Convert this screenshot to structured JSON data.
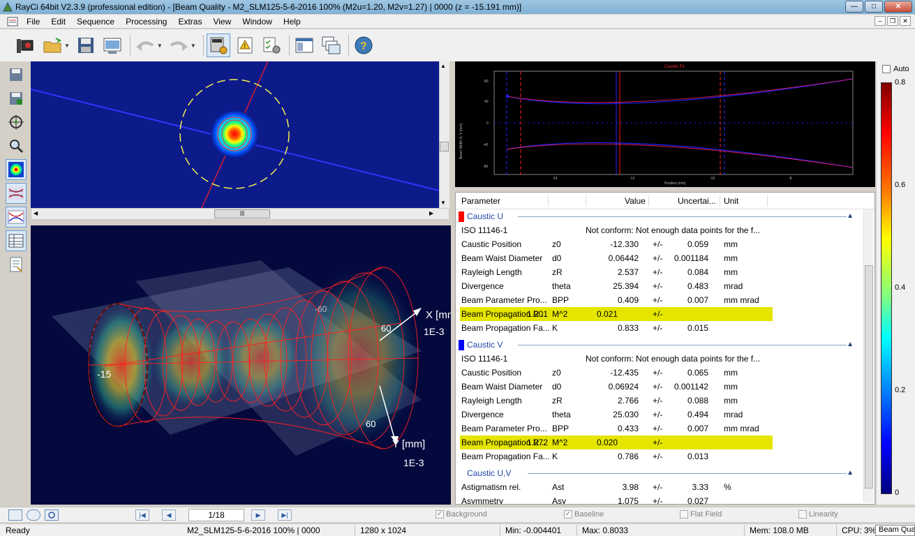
{
  "window": {
    "title": "RayCi 64bit V2.3.9 (professional edition) - [Beam Quality - M2_SLM125-5-6-2016 100% (M2u=1.20, M2v=1.27) | 0000 (z = -15.191 mm)]",
    "minimize": "—",
    "maximize": "□",
    "close": "✕"
  },
  "menu": {
    "items": [
      "File",
      "Edit",
      "Sequence",
      "Processing",
      "Extras",
      "View",
      "Window",
      "Help"
    ],
    "mdi_min": "–",
    "mdi_restore": "❒",
    "mdi_close": "✕"
  },
  "caustic_chart": {
    "title": "Caustic Fit",
    "ylabel": "Beam Width U, V [mm]",
    "xlabel": "Position [mm]",
    "yticks": [
      "80",
      "40",
      "0",
      "-40",
      "-80"
    ],
    "xticks": [
      "-14",
      "-12",
      "-10",
      "-8"
    ]
  },
  "view3d": {
    "x_axis": "X [mm]",
    "x_unit": "1E-3",
    "y_axis": "Y [mm]",
    "y_unit": "1E-3",
    "label_60_top": "60",
    "label_60_bottom": "60",
    "label_minus60": "-60",
    "label_minus15": "-15"
  },
  "params": {
    "headers": {
      "parameter": "Parameter",
      "value": "Value",
      "uncertainty": "Uncertai...",
      "unit": "Unit"
    },
    "groups": [
      {
        "name": "Caustic U",
        "color": "#ff0000"
      },
      {
        "name": "Caustic V",
        "color": "#0000ff"
      },
      {
        "name": "Caustic U,V",
        "color": ""
      }
    ],
    "rows_u": [
      {
        "name": "ISO 11146-1",
        "sym": "",
        "value": "Not conform: Not enough data points for the f...",
        "pm": "",
        "unc": "",
        "unit": ""
      },
      {
        "name": "Caustic Position",
        "sym": "z0",
        "value": "-12.330",
        "pm": "+/-",
        "unc": "0.059",
        "unit": "mm"
      },
      {
        "name": "Beam Waist Diameter",
        "sym": "d0",
        "value": "0.06442",
        "pm": "+/-",
        "unc": "0.001184",
        "unit": "mm"
      },
      {
        "name": "Rayleigh Length",
        "sym": "zR",
        "value": "2.537",
        "pm": "+/-",
        "unc": "0.084",
        "unit": "mm"
      },
      {
        "name": "Divergence",
        "sym": "theta",
        "value": "25.394",
        "pm": "+/-",
        "unc": "0.483",
        "unit": "mrad"
      },
      {
        "name": "Beam Parameter Pro...",
        "sym": "BPP",
        "value": "0.409",
        "pm": "+/-",
        "unc": "0.007",
        "unit": "mm mrad"
      },
      {
        "name": "Beam Propagation R...",
        "sym": "M^2",
        "value": "1.201",
        "pm": "+/-",
        "unc": "0.021",
        "unit": ""
      },
      {
        "name": "Beam Propagation Fa...",
        "sym": "K",
        "value": "0.833",
        "pm": "+/-",
        "unc": "0.015",
        "unit": ""
      }
    ],
    "rows_v": [
      {
        "name": "ISO 11146-1",
        "sym": "",
        "value": "Not conform: Not enough data points for the f...",
        "pm": "",
        "unc": "",
        "unit": ""
      },
      {
        "name": "Caustic Position",
        "sym": "z0",
        "value": "-12.435",
        "pm": "+/-",
        "unc": "0.065",
        "unit": "mm"
      },
      {
        "name": "Beam Waist Diameter",
        "sym": "d0",
        "value": "0.06924",
        "pm": "+/-",
        "unc": "0.001142",
        "unit": "mm"
      },
      {
        "name": "Rayleigh Length",
        "sym": "zR",
        "value": "2.766",
        "pm": "+/-",
        "unc": "0.088",
        "unit": "mm"
      },
      {
        "name": "Divergence",
        "sym": "theta",
        "value": "25.030",
        "pm": "+/-",
        "unc": "0.494",
        "unit": "mrad"
      },
      {
        "name": "Beam Parameter Pro...",
        "sym": "BPP",
        "value": "0.433",
        "pm": "+/-",
        "unc": "0.007",
        "unit": "mm mrad"
      },
      {
        "name": "Beam Propagation R...",
        "sym": "M^2",
        "value": "1.272",
        "pm": "+/-",
        "unc": "0.020",
        "unit": ""
      },
      {
        "name": "Beam Propagation Fa...",
        "sym": "K",
        "value": "0.786",
        "pm": "+/-",
        "unc": "0.013",
        "unit": ""
      }
    ],
    "rows_uv": [
      {
        "name": "Astigmatism rel.",
        "sym": "Ast",
        "value": "3.98",
        "pm": "+/-",
        "unc": "3.33",
        "unit": "%"
      },
      {
        "name": "Asymmetry",
        "sym": "Asy",
        "value": "1.075",
        "pm": "+/-",
        "unc": "0.027",
        "unit": ""
      }
    ]
  },
  "colorbar": {
    "auto_label": "Auto",
    "ticks": [
      "0.8",
      "0.6",
      "0.4",
      "0.2",
      "0"
    ]
  },
  "bottombar": {
    "frame": "1/18",
    "background": "Background",
    "baseline": "Baseline",
    "flat_field": "Flat Field",
    "linearity": "Linearity",
    "background_checked": true,
    "baseline_checked": true,
    "flat_field_checked": false,
    "linearity_checked": false
  },
  "status": {
    "ready": "Ready",
    "file": "M2_SLM125-5-6-2016 100% | 0000",
    "resolution": "1280 x 1024",
    "min": "Min: -0.004401",
    "max": "Max: 0.8033",
    "mem": "Mem: 108.0 MB",
    "cpu": "CPU: 3%",
    "tab": "Beam Qua"
  }
}
